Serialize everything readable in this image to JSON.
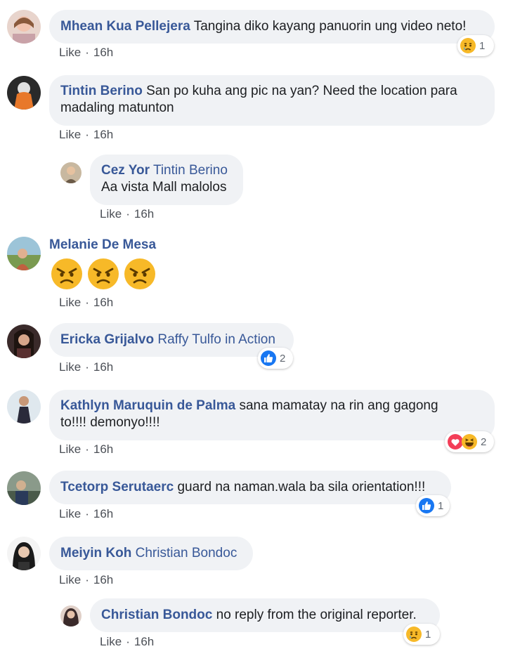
{
  "comments": [
    {
      "id": "c1",
      "author": "Mhean Kua Pellejera",
      "text": "Tangina diko kayang panuorin ung video neto!",
      "like_label": "Like",
      "time": "16h",
      "reaction_count": "1"
    },
    {
      "id": "c2",
      "author": "Tintin Berino",
      "text_line1": "San po kuha ang pic na yan? Need the location para",
      "text_line2": "madaling matunton",
      "like_label": "Like",
      "time": "16h",
      "reply": {
        "author": "Cez Yor",
        "tag": "Tintin Berino",
        "text": "Aa vista Mall malolos",
        "like_label": "Like",
        "time": "16h"
      }
    },
    {
      "id": "c3",
      "author": "Melanie De Mesa",
      "emojis": [
        "angry-face",
        "angry-face",
        "angry-face"
      ],
      "like_label": "Like",
      "time": "16h"
    },
    {
      "id": "c4",
      "author": "Ericka Grijalvo",
      "tag": "Raffy Tulfo in Action",
      "like_label": "Like",
      "time": "16h",
      "reaction_count": "2"
    },
    {
      "id": "c5",
      "author": "Kathlyn Maruquin de Palma",
      "text_line1": "sana mamatay na rin ang gagong",
      "text_line2": "to!!!! demonyo!!!!",
      "like_label": "Like",
      "time": "16h",
      "reaction_count": "2"
    },
    {
      "id": "c6",
      "author": "Tcetorp Serutaerc",
      "text": "guard na naman.wala ba sila orientation!!!",
      "like_label": "Like",
      "time": "16h",
      "reaction_count": "1"
    },
    {
      "id": "c7",
      "author": "Meiyin Koh",
      "tag": "Christian Bondoc",
      "like_label": "Like",
      "time": "16h",
      "reply": {
        "author": "Christian Bondoc",
        "text": "no reply from the original reporter.",
        "like_label": "Like",
        "time": "16h",
        "reaction_count": "1"
      }
    }
  ],
  "colors": {
    "name": "#385898",
    "bubble": "#f0f2f5",
    "like_blue": "#1877f2",
    "love_red": "#f33e58",
    "emoji_yellow": "#f7b928"
  }
}
